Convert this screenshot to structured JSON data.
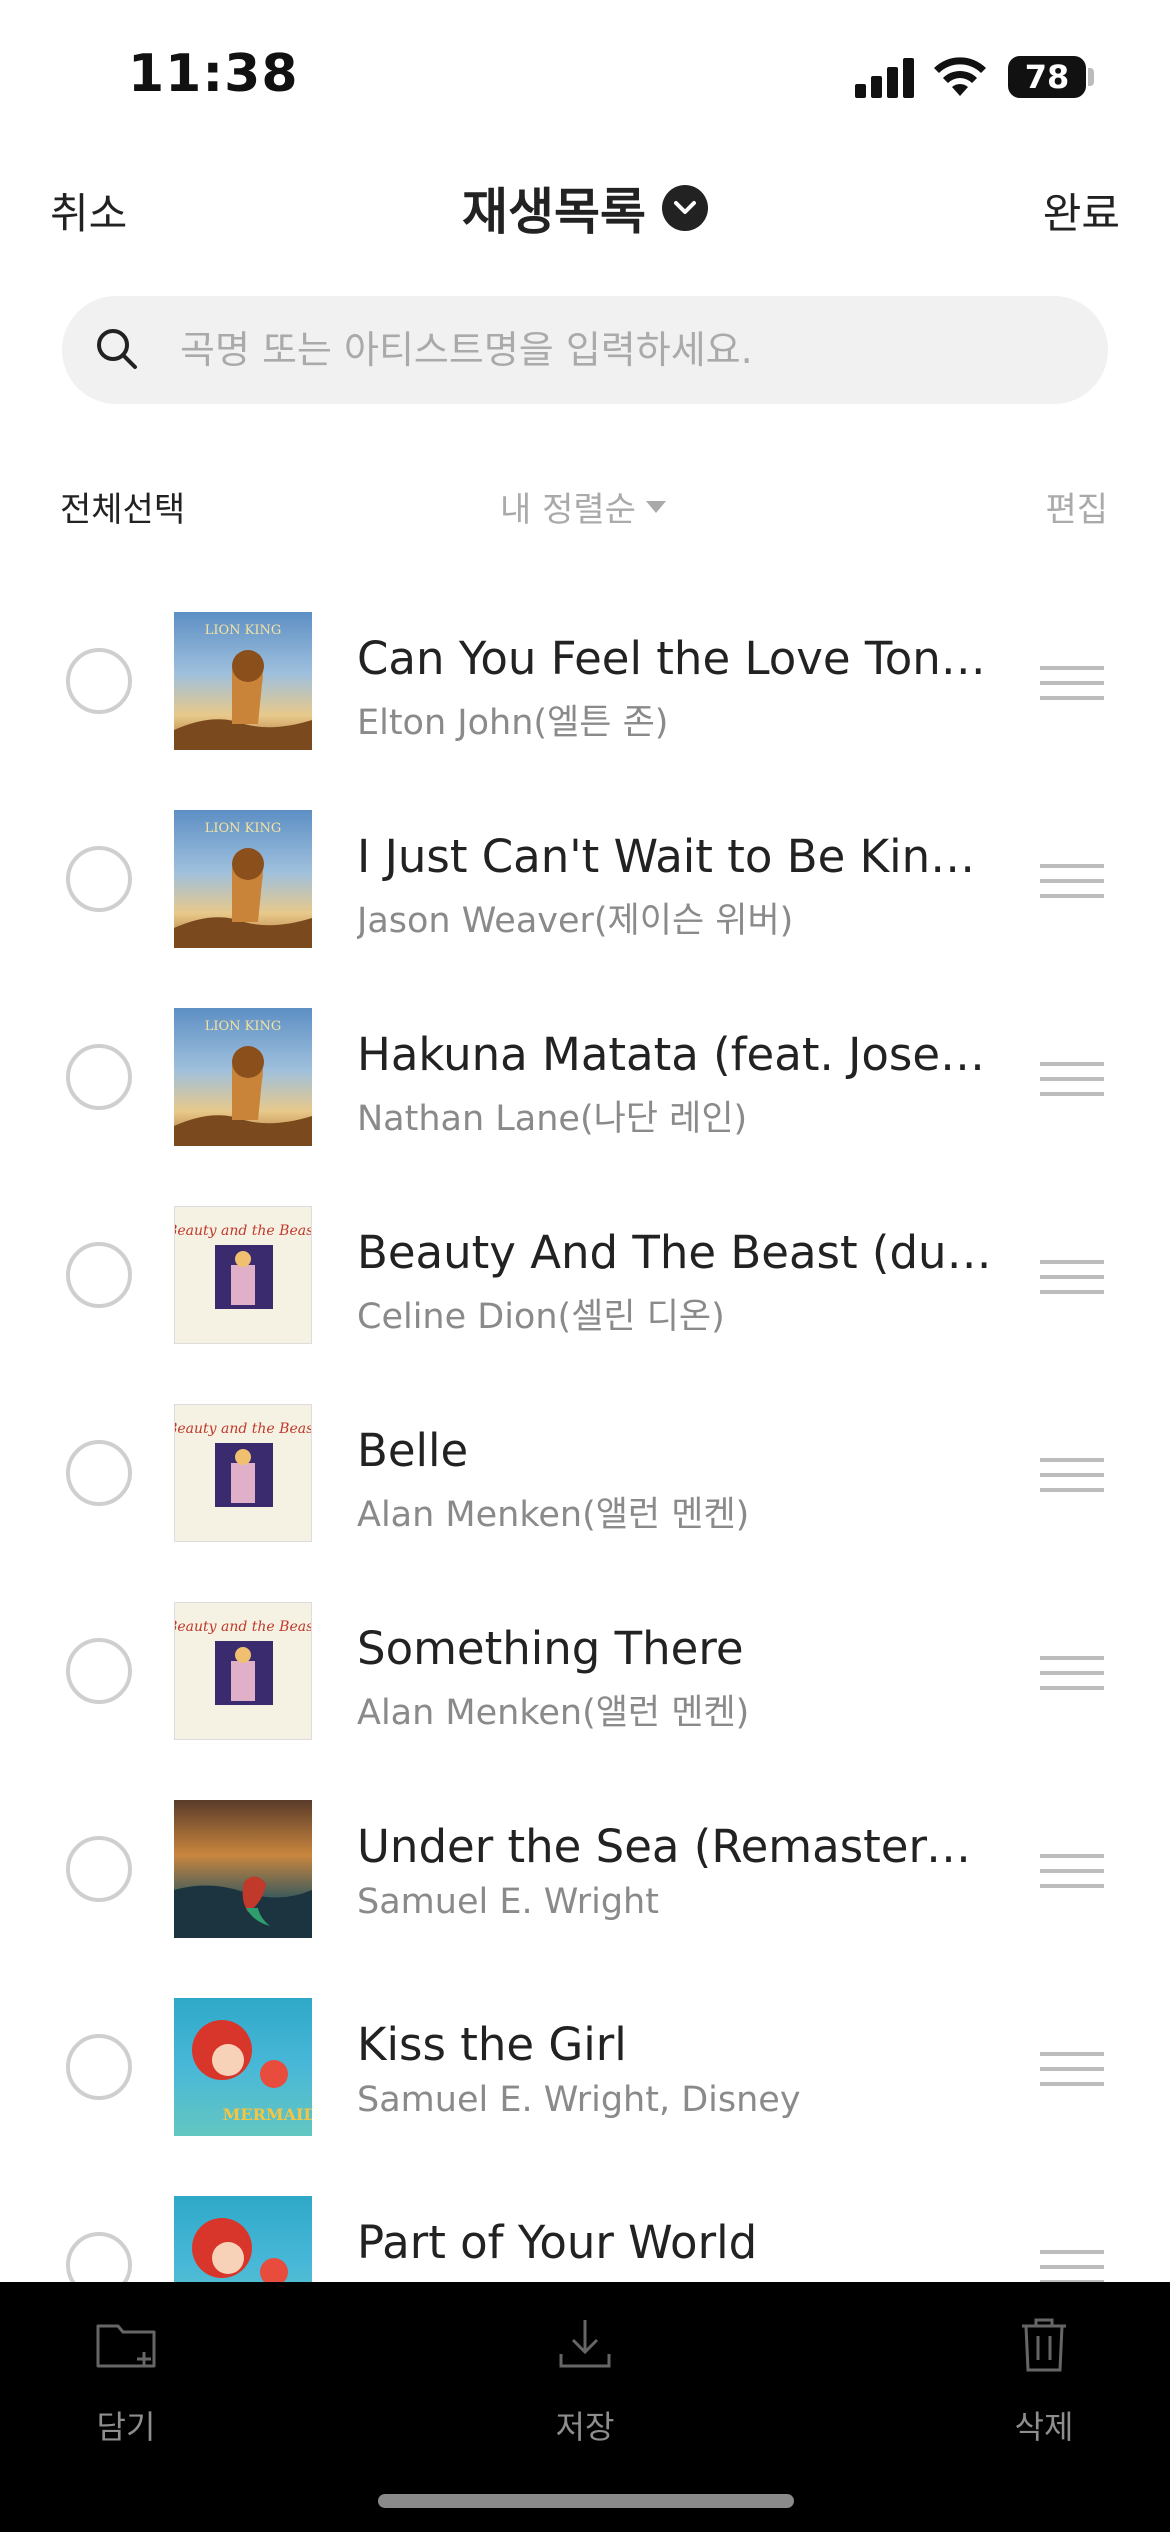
{
  "status_bar": {
    "time": "11:38",
    "battery": "78"
  },
  "header": {
    "cancel_label": "취소",
    "title": "재생목록",
    "done_label": "완료"
  },
  "search": {
    "placeholder": "곡명 또는 아티스트명을 입력하세요."
  },
  "controls": {
    "select_all_label": "전체선택",
    "sort_label": "내 정렬순",
    "edit_label": "편집"
  },
  "songs": [
    {
      "title": "Can You Feel the Love Tonig…",
      "artist": "Elton John(엘튼 존)",
      "album_art": "lion-king-cover"
    },
    {
      "title": "I Just Can't Wait to Be King (…",
      "artist": "Jason Weaver(제이슨 위버)",
      "album_art": "lion-king-cover"
    },
    {
      "title": "Hakuna Matata (feat. Joseph…",
      "artist": "Nathan Lane(나단 레인)",
      "album_art": "lion-king-cover"
    },
    {
      "title": "Beauty And The Beast (duet…",
      "artist": "Celine Dion(셀린 디온)",
      "album_art": "beauty-and-the-beast-cover"
    },
    {
      "title": "Belle",
      "artist": "Alan Menken(앨런 멘켄)",
      "album_art": "beauty-and-the-beast-cover"
    },
    {
      "title": "Something There",
      "artist": "Alan Menken(앨런 멘켄)",
      "album_art": "beauty-and-the-beast-cover"
    },
    {
      "title": "Under the Sea (Remastered…",
      "artist": "Samuel E. Wright",
      "album_art": "little-mermaid-sea-cover"
    },
    {
      "title": "Kiss the Girl",
      "artist": "Samuel E. Wright, Disney",
      "album_art": "little-mermaid-cover"
    },
    {
      "title": "Part of Your World",
      "artist": "",
      "album_art": "little-mermaid-cover"
    }
  ],
  "bottom_bar": {
    "add_label": "담기",
    "save_label": "저장",
    "delete_label": "삭제"
  },
  "colors": {
    "background": "#ffffff",
    "text_primary": "#222222",
    "text_secondary": "#8a8a8a",
    "search_bg": "#f1f1f1",
    "bottom_bar_bg": "#000000"
  }
}
